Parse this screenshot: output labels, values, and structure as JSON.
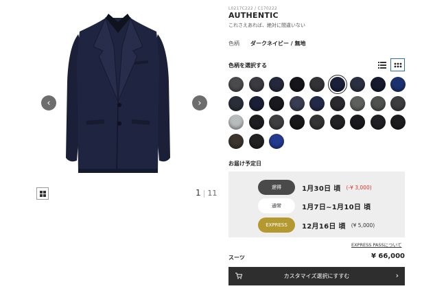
{
  "product": {
    "code": "L0217C222 / C170222",
    "name": "AUTHENTIC",
    "description": "これさえあれば、絶対に間違いない",
    "color_label": "色柄",
    "color_value": "ダークネイビー / 無地"
  },
  "gallery": {
    "prev_icon": "‹",
    "next_icon": "›",
    "current_page": "1",
    "separator": "|",
    "total_pages": "11"
  },
  "swatch_section": {
    "title": "色柄を選択する",
    "view_modes": [
      "list-icon",
      "grid-icon"
    ],
    "active_view": "grid-icon",
    "selected_index": 5,
    "swatches": [
      "#4b4b4e",
      "#3a3a40",
      "#24283a",
      "#16161a",
      "#333336",
      "#1a2038",
      "#2b3040",
      "#161a2c",
      "#1c3170",
      "#2a2e38",
      "#1a1f36",
      "#1a1a1e",
      "#3a3d52",
      "#232a48",
      "#2a2a2e",
      "#5e605e",
      "#4e524e",
      "#3d3d40",
      "#b8bcbc",
      "#1e1e20",
      "#3e3e40",
      "#18181a",
      "#343434",
      "#222224",
      "#1a1a1c",
      "#202022",
      "#1c1c1e",
      "#3c342e",
      "#222222",
      "#233a8e"
    ]
  },
  "delivery": {
    "title": "お届け予定日",
    "options": [
      {
        "label": "通常",
        "date": "1月7日~1月10日 頃",
        "note": "",
        "style": "white"
      },
      {
        "label": "遅得",
        "date": "1月30日 頃",
        "note": "(-¥ 3,000)",
        "style": "dark"
      },
      {
        "label": "EXPRESS",
        "date": "12月16日 頃",
        "note": "(¥ 5,000)",
        "style": "gold"
      }
    ],
    "express_link": "EXPRESS PASSについて"
  },
  "summary": {
    "label": "スーツ",
    "price": "¥ 66,000",
    "cta": "カスタマイズ選択にすすむ",
    "cta_icon": "cart-icon",
    "cta_arrow": "›"
  },
  "colors": {
    "accent_blue": "#2c6db6",
    "express_gold": "#b3992f",
    "discount_red": "#d9322b",
    "cta_bg": "#2e2e2e"
  }
}
